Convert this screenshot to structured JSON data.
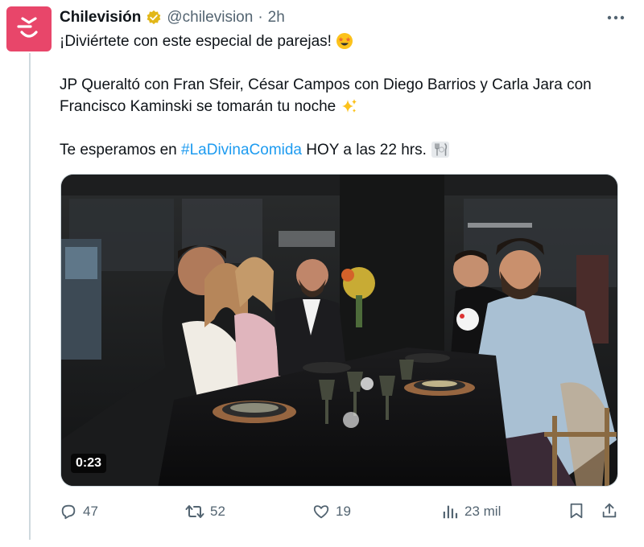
{
  "author": {
    "display_name": "Chilevisión",
    "handle": "@chilevision",
    "separator": "·",
    "time": "2h",
    "brand_color": "#e8466a"
  },
  "tweet": {
    "line1": "¡Diviértete con este especial de parejas!",
    "line1_emoji": "star-struck-emoji",
    "line2": "JP Queraltó con Fran Sfeir, César Campos con Diego Barrios y Carla Jara con Francisco Kaminski se tomarán tu noche",
    "line2_emoji": "sparkles-emoji",
    "line3_prefix": "Te esperamos en",
    "hashtag": "#LaDivinaComida",
    "line3_suffix": "HOY a las 22 hrs.",
    "line3_emoji": "fork-and-knife-emoji",
    "hashtag_color": "#1d9bf0"
  },
  "media": {
    "type": "video",
    "duration": "0:23"
  },
  "actions": {
    "replies": "47",
    "reposts": "52",
    "likes": "19",
    "views": "23 mil"
  }
}
